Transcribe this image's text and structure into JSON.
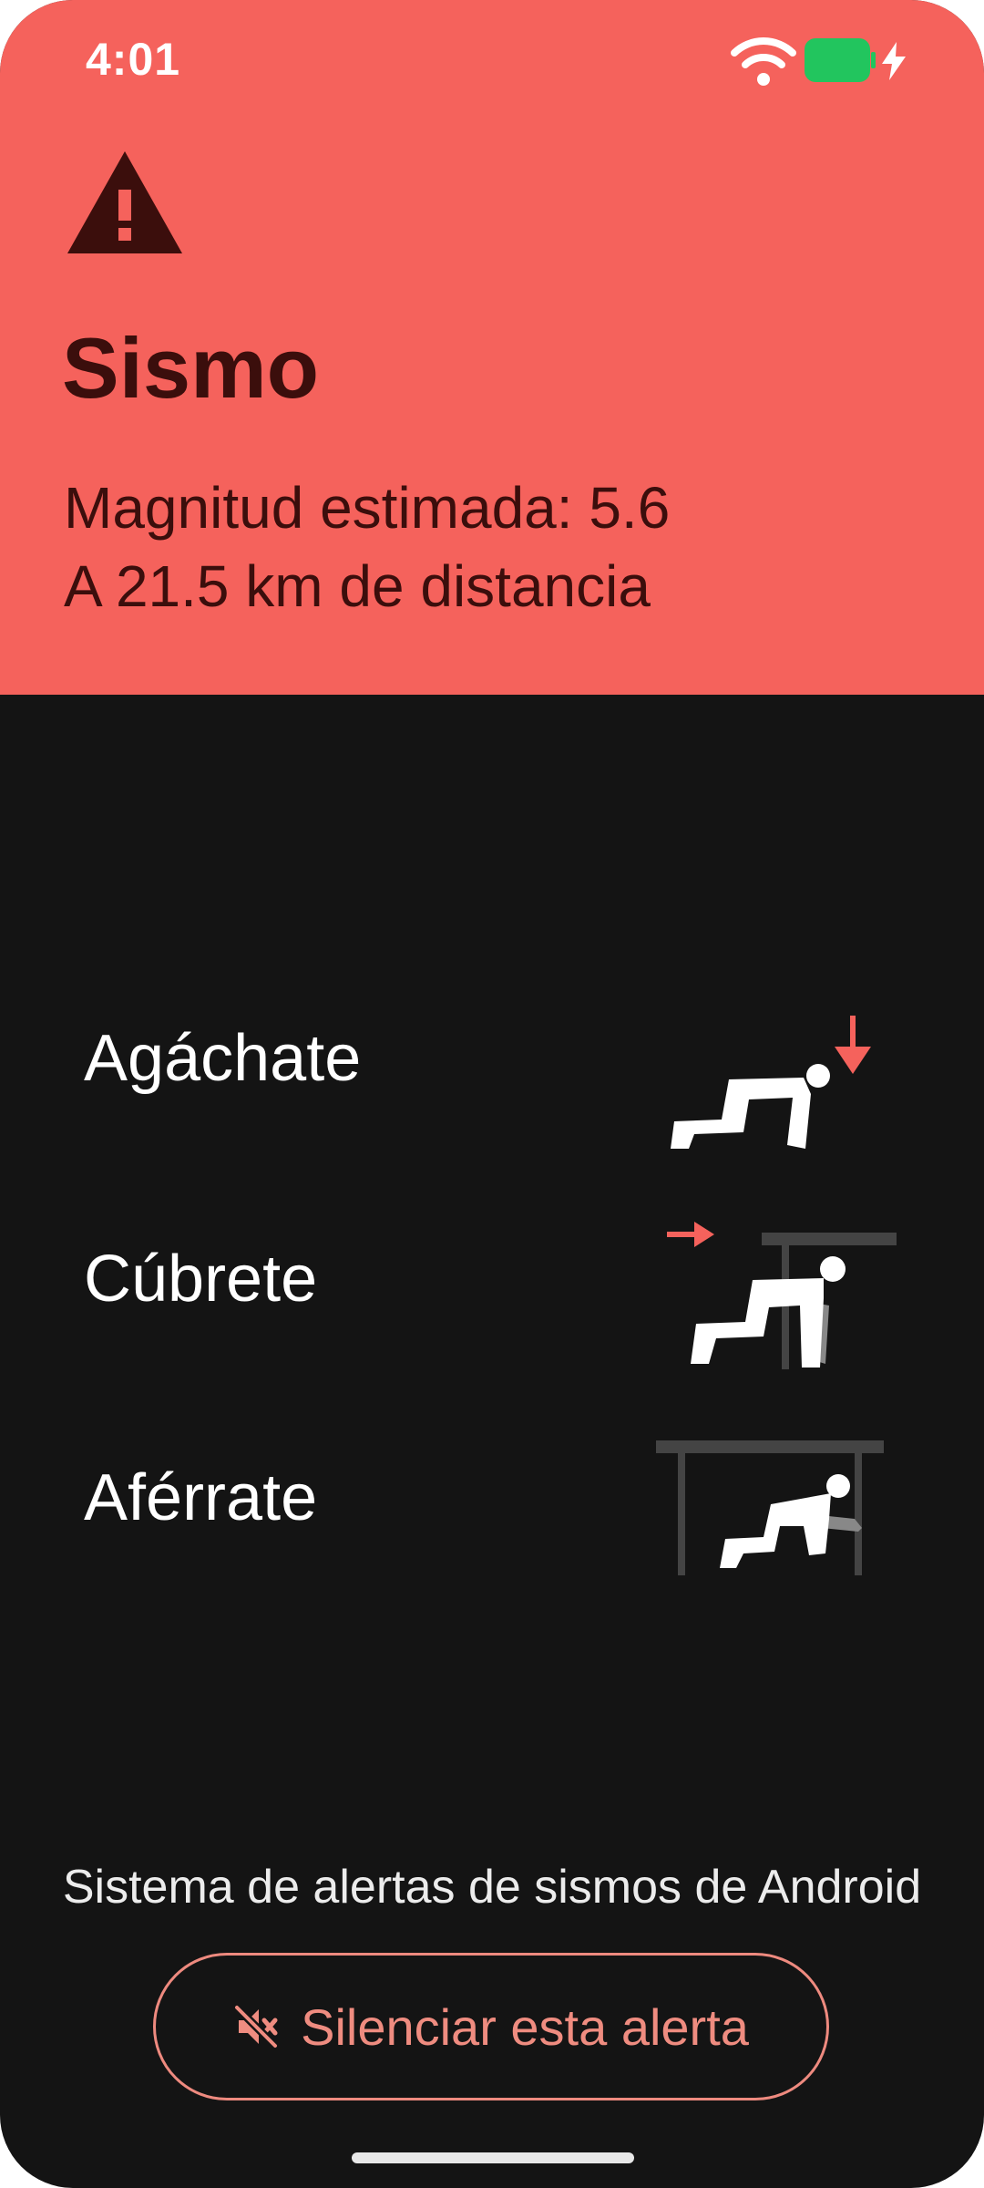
{
  "status_bar": {
    "time": "4:01",
    "battery_color": "#22c55e"
  },
  "alert": {
    "title": "Sismo",
    "magnitude": "Magnitud estimada: 5.6",
    "distance": "A 21.5 km de distancia",
    "background_color": "#f5625c",
    "icon": "warning-triangle-icon"
  },
  "instructions": [
    {
      "label": "Agáchate",
      "icon": "drop-pose-icon"
    },
    {
      "label": "Cúbrete",
      "icon": "cover-pose-icon"
    },
    {
      "label": "Aférrate",
      "icon": "hold-on-pose-icon"
    }
  ],
  "footer": {
    "system_name": "Sistema de alertas de sismos de Android",
    "mute_button": {
      "label": "Silenciar esta alerta",
      "icon": "volume-off-icon"
    }
  },
  "colors": {
    "accent": "#ef8c80",
    "background": "#141414"
  }
}
